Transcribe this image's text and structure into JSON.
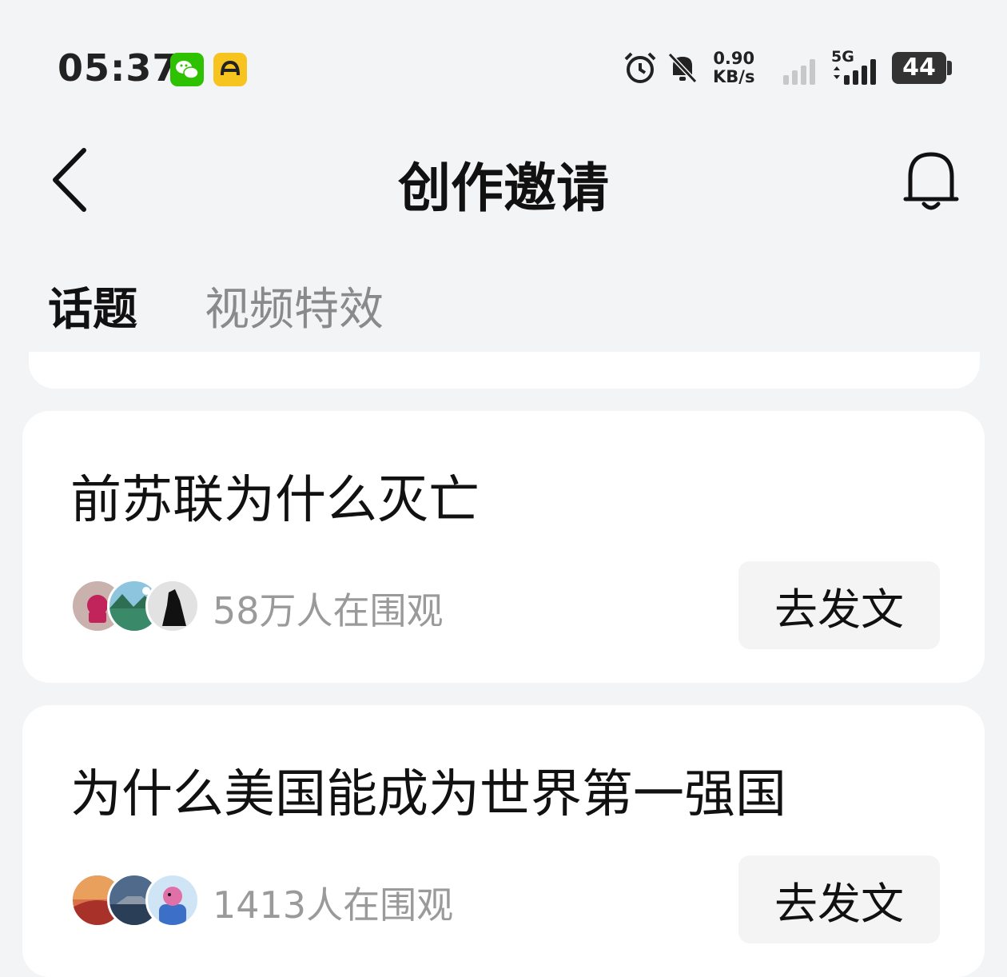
{
  "status_bar": {
    "time": "05:37",
    "net_speed_value": "0.90",
    "net_speed_unit": "KB/s",
    "network_type": "5G",
    "battery": "44",
    "icons": [
      "wechat-icon",
      "yellow-app-icon",
      "alarm-icon",
      "mute-bell-icon",
      "signal-icon",
      "5g-signal-icon",
      "battery-icon"
    ]
  },
  "header": {
    "title": "创作邀请",
    "back_icon": "chevron-left-icon",
    "bell_icon": "bell-icon"
  },
  "tabs": [
    {
      "label": "话题",
      "active": true
    },
    {
      "label": "视频特效",
      "active": false
    }
  ],
  "topics": [
    {
      "title": "前苏联为什么灭亡",
      "viewers": "58万人在围观",
      "button": "去发文"
    },
    {
      "title": "为什么美国能成为世界第一强国",
      "viewers": "1413人在围观",
      "button": "去发文"
    }
  ]
}
